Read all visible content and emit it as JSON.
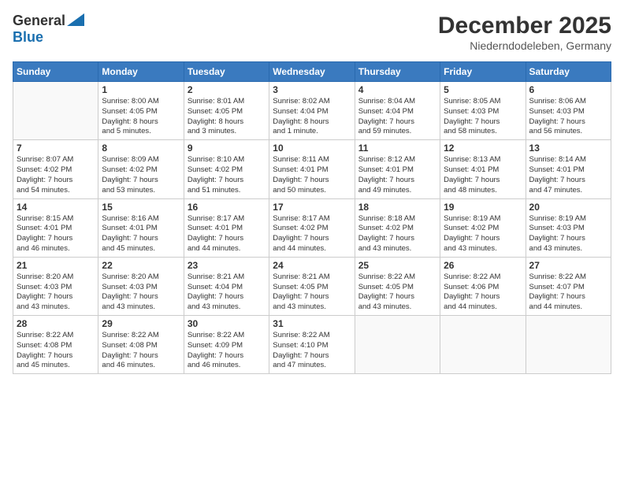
{
  "header": {
    "logo_general": "General",
    "logo_blue": "Blue",
    "month": "December 2025",
    "location": "Niederndodeleben, Germany"
  },
  "days_of_week": [
    "Sunday",
    "Monday",
    "Tuesday",
    "Wednesday",
    "Thursday",
    "Friday",
    "Saturday"
  ],
  "weeks": [
    [
      {
        "day": "",
        "info": ""
      },
      {
        "day": "1",
        "info": "Sunrise: 8:00 AM\nSunset: 4:05 PM\nDaylight: 8 hours\nand 5 minutes."
      },
      {
        "day": "2",
        "info": "Sunrise: 8:01 AM\nSunset: 4:05 PM\nDaylight: 8 hours\nand 3 minutes."
      },
      {
        "day": "3",
        "info": "Sunrise: 8:02 AM\nSunset: 4:04 PM\nDaylight: 8 hours\nand 1 minute."
      },
      {
        "day": "4",
        "info": "Sunrise: 8:04 AM\nSunset: 4:04 PM\nDaylight: 7 hours\nand 59 minutes."
      },
      {
        "day": "5",
        "info": "Sunrise: 8:05 AM\nSunset: 4:03 PM\nDaylight: 7 hours\nand 58 minutes."
      },
      {
        "day": "6",
        "info": "Sunrise: 8:06 AM\nSunset: 4:03 PM\nDaylight: 7 hours\nand 56 minutes."
      }
    ],
    [
      {
        "day": "7",
        "info": "Sunrise: 8:07 AM\nSunset: 4:02 PM\nDaylight: 7 hours\nand 54 minutes."
      },
      {
        "day": "8",
        "info": "Sunrise: 8:09 AM\nSunset: 4:02 PM\nDaylight: 7 hours\nand 53 minutes."
      },
      {
        "day": "9",
        "info": "Sunrise: 8:10 AM\nSunset: 4:02 PM\nDaylight: 7 hours\nand 51 minutes."
      },
      {
        "day": "10",
        "info": "Sunrise: 8:11 AM\nSunset: 4:01 PM\nDaylight: 7 hours\nand 50 minutes."
      },
      {
        "day": "11",
        "info": "Sunrise: 8:12 AM\nSunset: 4:01 PM\nDaylight: 7 hours\nand 49 minutes."
      },
      {
        "day": "12",
        "info": "Sunrise: 8:13 AM\nSunset: 4:01 PM\nDaylight: 7 hours\nand 48 minutes."
      },
      {
        "day": "13",
        "info": "Sunrise: 8:14 AM\nSunset: 4:01 PM\nDaylight: 7 hours\nand 47 minutes."
      }
    ],
    [
      {
        "day": "14",
        "info": "Sunrise: 8:15 AM\nSunset: 4:01 PM\nDaylight: 7 hours\nand 46 minutes."
      },
      {
        "day": "15",
        "info": "Sunrise: 8:16 AM\nSunset: 4:01 PM\nDaylight: 7 hours\nand 45 minutes."
      },
      {
        "day": "16",
        "info": "Sunrise: 8:17 AM\nSunset: 4:01 PM\nDaylight: 7 hours\nand 44 minutes."
      },
      {
        "day": "17",
        "info": "Sunrise: 8:17 AM\nSunset: 4:02 PM\nDaylight: 7 hours\nand 44 minutes."
      },
      {
        "day": "18",
        "info": "Sunrise: 8:18 AM\nSunset: 4:02 PM\nDaylight: 7 hours\nand 43 minutes."
      },
      {
        "day": "19",
        "info": "Sunrise: 8:19 AM\nSunset: 4:02 PM\nDaylight: 7 hours\nand 43 minutes."
      },
      {
        "day": "20",
        "info": "Sunrise: 8:19 AM\nSunset: 4:03 PM\nDaylight: 7 hours\nand 43 minutes."
      }
    ],
    [
      {
        "day": "21",
        "info": "Sunrise: 8:20 AM\nSunset: 4:03 PM\nDaylight: 7 hours\nand 43 minutes."
      },
      {
        "day": "22",
        "info": "Sunrise: 8:20 AM\nSunset: 4:03 PM\nDaylight: 7 hours\nand 43 minutes."
      },
      {
        "day": "23",
        "info": "Sunrise: 8:21 AM\nSunset: 4:04 PM\nDaylight: 7 hours\nand 43 minutes."
      },
      {
        "day": "24",
        "info": "Sunrise: 8:21 AM\nSunset: 4:05 PM\nDaylight: 7 hours\nand 43 minutes."
      },
      {
        "day": "25",
        "info": "Sunrise: 8:22 AM\nSunset: 4:05 PM\nDaylight: 7 hours\nand 43 minutes."
      },
      {
        "day": "26",
        "info": "Sunrise: 8:22 AM\nSunset: 4:06 PM\nDaylight: 7 hours\nand 44 minutes."
      },
      {
        "day": "27",
        "info": "Sunrise: 8:22 AM\nSunset: 4:07 PM\nDaylight: 7 hours\nand 44 minutes."
      }
    ],
    [
      {
        "day": "28",
        "info": "Sunrise: 8:22 AM\nSunset: 4:08 PM\nDaylight: 7 hours\nand 45 minutes."
      },
      {
        "day": "29",
        "info": "Sunrise: 8:22 AM\nSunset: 4:08 PM\nDaylight: 7 hours\nand 46 minutes."
      },
      {
        "day": "30",
        "info": "Sunrise: 8:22 AM\nSunset: 4:09 PM\nDaylight: 7 hours\nand 46 minutes."
      },
      {
        "day": "31",
        "info": "Sunrise: 8:22 AM\nSunset: 4:10 PM\nDaylight: 7 hours\nand 47 minutes."
      },
      {
        "day": "",
        "info": ""
      },
      {
        "day": "",
        "info": ""
      },
      {
        "day": "",
        "info": ""
      }
    ]
  ]
}
